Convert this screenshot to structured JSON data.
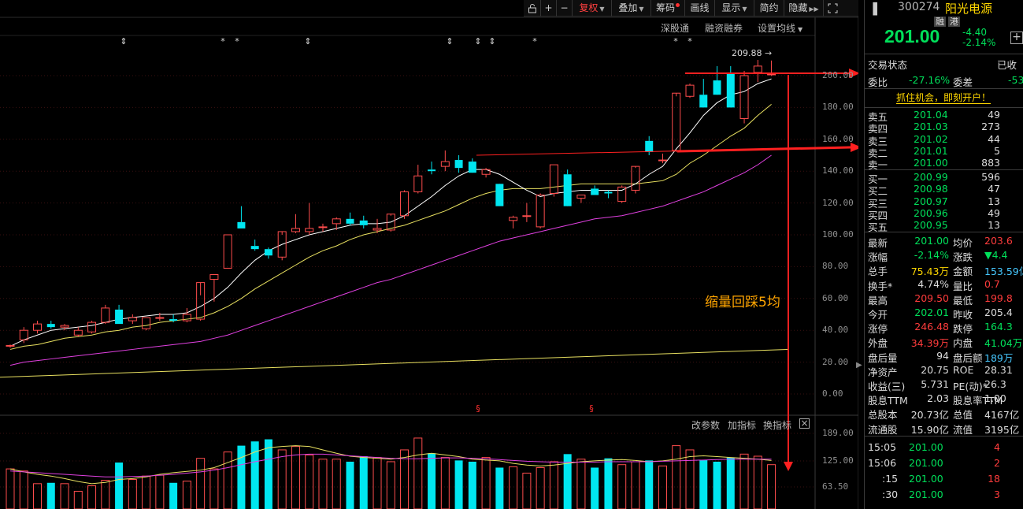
{
  "toolbar": {
    "items": [
      {
        "label": "",
        "name": "lock-icon"
      },
      {
        "label": "+",
        "name": "zoom-in-button"
      },
      {
        "label": "−",
        "name": "zoom-out-button"
      },
      {
        "label": "复权",
        "name": "adjust-button"
      },
      {
        "label": "叠加",
        "name": "overlay-button"
      },
      {
        "label": "筹码",
        "name": "chips-button"
      },
      {
        "label": "画线",
        "name": "draw-line-button"
      },
      {
        "label": "显示",
        "name": "display-button"
      },
      {
        "label": "简约",
        "name": "simple-button"
      },
      {
        "label": "隐藏",
        "name": "hide-button"
      }
    ],
    "expand_icon": "expand-icon"
  },
  "links": {
    "hk_connect": "深股通",
    "margin": "融资融券",
    "ma_settings": "设置均线"
  },
  "price_axis": [
    "200.00",
    "180.00",
    "160.00",
    "140.00",
    "120.00",
    "100.00",
    "80.00",
    "60.00",
    "40.00",
    "20.00",
    "0.00"
  ],
  "high_label": "209.88",
  "annotation": "缩量回踩5均",
  "volume_panel": {
    "params": "改参数",
    "add_indicator": "加指标",
    "switch_indicator": "换指标",
    "axis": [
      "189.00",
      "125.00",
      "63.50"
    ]
  },
  "marker_symbols": {
    "star": "*",
    "arrow": "⇕",
    "s": "§"
  },
  "stock": {
    "code": "300274",
    "name": "阳光电源",
    "badge_margin": "融",
    "badge_hk": "港",
    "price": "201.00",
    "change": "-4.40",
    "change_pct": "-2.14%",
    "status_label": "交易状态",
    "status_value": "已收",
    "ratio_label": "委比",
    "ratio_value": "-27.16%",
    "diff_label": "委差",
    "diff_value": "-53",
    "promo": "抓住机会，即刻开户！"
  },
  "asks": [
    {
      "label": "卖五",
      "price": "201.04",
      "vol": "49"
    },
    {
      "label": "卖四",
      "price": "201.03",
      "vol": "273"
    },
    {
      "label": "卖三",
      "price": "201.02",
      "vol": "44"
    },
    {
      "label": "卖二",
      "price": "201.01",
      "vol": "5"
    },
    {
      "label": "卖一",
      "price": "201.00",
      "vol": "883"
    }
  ],
  "bids": [
    {
      "label": "买一",
      "price": "200.99",
      "vol": "596"
    },
    {
      "label": "买二",
      "price": "200.98",
      "vol": "47"
    },
    {
      "label": "买三",
      "price": "200.97",
      "vol": "13"
    },
    {
      "label": "买四",
      "price": "200.96",
      "vol": "49"
    },
    {
      "label": "买五",
      "price": "200.95",
      "vol": "13"
    }
  ],
  "stats": [
    {
      "l1": "最新",
      "v1": "201.00",
      "c1": "green",
      "l2": "均价",
      "v2": "203.6",
      "c2": "red"
    },
    {
      "l1": "涨幅",
      "v1": "-2.14%",
      "c1": "green",
      "l2": "涨跌",
      "v2": "▼4.4",
      "c2": "green"
    },
    {
      "l1": "总手",
      "v1": "75.43万",
      "c1": "yellow",
      "l2": "金额",
      "v2": "153.59亿",
      "c2": "cyan"
    },
    {
      "l1": "换手*",
      "v1": "4.74%",
      "c1": "white",
      "l2": "量比",
      "v2": "0.7",
      "c2": "red"
    },
    {
      "l1": "最高",
      "v1": "209.50",
      "c1": "red",
      "l2": "最低",
      "v2": "199.8",
      "c2": "red"
    },
    {
      "l1": "今开",
      "v1": "202.01",
      "c1": "green",
      "l2": "昨收",
      "v2": "205.4",
      "c2": "white"
    },
    {
      "l1": "涨停",
      "v1": "246.48",
      "c1": "red",
      "l2": "跌停",
      "v2": "164.3",
      "c2": "green"
    },
    {
      "l1": "外盘",
      "v1": "34.39万",
      "c1": "red",
      "l2": "内盘",
      "v2": "41.04万",
      "c2": "green"
    },
    {
      "l1": "盘后量",
      "v1": "94",
      "c1": "white",
      "l2": "盘后额",
      "v2": "189万",
      "c2": "cyan"
    },
    {
      "l1": "净资产",
      "v1": "20.75",
      "c1": "white",
      "l2": "ROE",
      "v2": "28.31",
      "c2": "white"
    },
    {
      "l1": "收益(三)",
      "v1": "5.731",
      "c1": "white",
      "l2": "PE(动)*",
      "v2": "26.3",
      "c2": "white"
    },
    {
      "l1": "股息TTM",
      "v1": "2.03",
      "c1": "white",
      "l2": "股息率TTM",
      "v2": "1.00",
      "c2": "white"
    },
    {
      "l1": "总股本",
      "v1": "20.73亿",
      "c1": "white",
      "l2": "总值",
      "v2": "4167亿",
      "c2": "white"
    },
    {
      "l1": "流通股",
      "v1": "15.90亿",
      "c1": "white",
      "l2": "流值",
      "v2": "3195亿",
      "c2": "white"
    }
  ],
  "ticks": [
    {
      "time": "15:05",
      "price": "201.00",
      "vol": "4"
    },
    {
      "time": "15:06",
      "price": "201.00",
      "vol": "2"
    },
    {
      "time": ":15",
      "price": "201.00",
      "vol": "18"
    },
    {
      "time": ":30",
      "price": "201.00",
      "vol": "3"
    }
  ],
  "chart_data": {
    "type": "candlestick",
    "ylim": [
      0,
      220
    ],
    "candles": [
      [
        30,
        31,
        29,
        30.5
      ],
      [
        34,
        42,
        32,
        40
      ],
      [
        40,
        46,
        38,
        44
      ],
      [
        44,
        46,
        41,
        42
      ],
      [
        42,
        44,
        40,
        43
      ],
      [
        37,
        42,
        36,
        40
      ],
      [
        39,
        46,
        38,
        45
      ],
      [
        45,
        56,
        44,
        54
      ],
      [
        53,
        56,
        44,
        44
      ],
      [
        46,
        50,
        44,
        48
      ],
      [
        41,
        48,
        40,
        48
      ],
      [
        48,
        51,
        46,
        48
      ],
      [
        47,
        50,
        45,
        46
      ],
      [
        46,
        54,
        45,
        50
      ],
      [
        47,
        62,
        46,
        70
      ],
      [
        72,
        75,
        58,
        75
      ],
      [
        79,
        100,
        79,
        100
      ],
      [
        108,
        118,
        104,
        104
      ],
      [
        93,
        97,
        90,
        91
      ],
      [
        91,
        92,
        85,
        87
      ],
      [
        86,
        100,
        84,
        102
      ],
      [
        102,
        113,
        101,
        104
      ],
      [
        102,
        120,
        100,
        104
      ],
      [
        105,
        107,
        102,
        105
      ],
      [
        107,
        111,
        103,
        110
      ],
      [
        110,
        114,
        106,
        107
      ],
      [
        109,
        112,
        104,
        106
      ],
      [
        103,
        110,
        101,
        104
      ],
      [
        103,
        112,
        102,
        113
      ],
      [
        112,
        128,
        110,
        127
      ],
      [
        127,
        144,
        126,
        137
      ],
      [
        141,
        146,
        138,
        140
      ],
      [
        143,
        153,
        140,
        146
      ],
      [
        147,
        150,
        139,
        142
      ],
      [
        146,
        148,
        140,
        139
      ],
      [
        138,
        142,
        136,
        141
      ],
      [
        132,
        131,
        118,
        118
      ],
      [
        109,
        112,
        104,
        111
      ],
      [
        112,
        120,
        108,
        112
      ],
      [
        105,
        126,
        104,
        125
      ],
      [
        126,
        144,
        124,
        144
      ],
      [
        138,
        141,
        123,
        118
      ],
      [
        123,
        125,
        120,
        125
      ],
      [
        129,
        131,
        126,
        125
      ],
      [
        127,
        128,
        123,
        126
      ],
      [
        121,
        131,
        120,
        130
      ],
      [
        128,
        142,
        126,
        143
      ],
      [
        159,
        162,
        150,
        152
      ],
      [
        147,
        151,
        145,
        147
      ],
      [
        153,
        187,
        152,
        189
      ],
      [
        187,
        195,
        186,
        194
      ],
      [
        188,
        198,
        182,
        180
      ],
      [
        197,
        206,
        195,
        188
      ],
      [
        201,
        206,
        182,
        180
      ],
      [
        173,
        203,
        170,
        200
      ],
      [
        202,
        209.88,
        196,
        206
      ],
      [
        201,
        209.5,
        199.8,
        201
      ]
    ],
    "ma5": [
      30,
      34,
      37,
      40,
      41,
      42,
      43,
      45,
      47,
      48,
      49,
      50,
      50,
      51,
      55,
      60,
      67,
      76,
      84,
      90,
      94,
      97,
      100,
      102,
      104,
      106,
      107,
      107,
      108,
      112,
      118,
      124,
      131,
      137,
      141,
      141,
      138,
      133,
      128,
      124,
      126,
      127,
      128,
      128,
      128,
      128,
      132,
      138,
      143,
      154,
      164,
      175,
      183,
      188,
      190,
      195,
      198
    ],
    "ma10": [
      28,
      30,
      31,
      33,
      35,
      36,
      37,
      39,
      40,
      42,
      43,
      45,
      46,
      47,
      48,
      51,
      55,
      60,
      66,
      71,
      76,
      81,
      86,
      90,
      93,
      97,
      100,
      102,
      104,
      106,
      109,
      112,
      115,
      119,
      123,
      126,
      128,
      129,
      129,
      129,
      130,
      131,
      132,
      132,
      132,
      132,
      132,
      133,
      134,
      138,
      145,
      150,
      156,
      162,
      167,
      175,
      182
    ],
    "ma30": [
      18,
      20,
      21,
      22,
      23,
      24,
      25,
      26,
      27,
      28,
      29,
      30,
      31,
      32,
      33,
      35,
      37,
      40,
      43,
      46,
      49,
      52,
      55,
      58,
      61,
      64,
      67,
      70,
      72,
      75,
      78,
      81,
      84,
      87,
      90,
      93,
      96,
      98,
      100,
      102,
      104,
      106,
      108,
      110,
      111,
      112,
      114,
      116,
      118,
      121,
      124,
      127,
      131,
      135,
      139,
      144,
      150
    ],
    "ma_long": [
      10.5,
      28
    ],
    "volume": [
      95,
      90,
      60,
      62,
      60,
      42,
      55,
      68,
      110,
      70,
      78,
      80,
      62,
      66,
      120,
      95,
      135,
      150,
      160,
      165,
      140,
      148,
      128,
      118,
      118,
      112,
      125,
      122,
      112,
      140,
      168,
      132,
      122,
      115,
      112,
      122,
      98,
      100,
      85,
      98,
      112,
      130,
      118,
      98,
      120,
      105,
      112,
      115,
      102,
      150,
      140,
      116,
      112,
      122,
      130,
      125,
      105
    ],
    "vol_ma1": [
      95,
      88,
      82,
      78,
      72,
      65,
      60,
      63,
      70,
      72,
      76,
      82,
      86,
      89,
      92,
      98,
      110,
      122,
      135,
      145,
      148,
      150,
      148,
      140,
      132,
      125,
      122,
      120,
      118,
      122,
      128,
      132,
      128,
      124,
      118,
      116,
      114,
      108,
      104,
      102,
      104,
      108,
      112,
      114,
      116,
      117,
      115,
      112,
      114,
      118,
      124,
      126,
      124,
      122,
      120,
      118,
      115
    ],
    "vol_ma2": [
      90,
      88,
      86,
      84,
      82,
      80,
      78,
      76,
      76,
      77,
      78,
      80,
      82,
      85,
      88,
      92,
      98,
      105,
      112,
      118,
      124,
      128,
      130,
      130,
      128,
      126,
      124,
      122,
      120,
      119,
      119,
      120,
      121,
      121,
      120,
      119,
      117,
      115,
      113,
      112,
      111,
      111,
      111,
      111,
      112,
      112,
      112,
      112,
      113,
      114,
      115,
      116,
      117,
      118,
      118,
      118,
      118
    ]
  }
}
